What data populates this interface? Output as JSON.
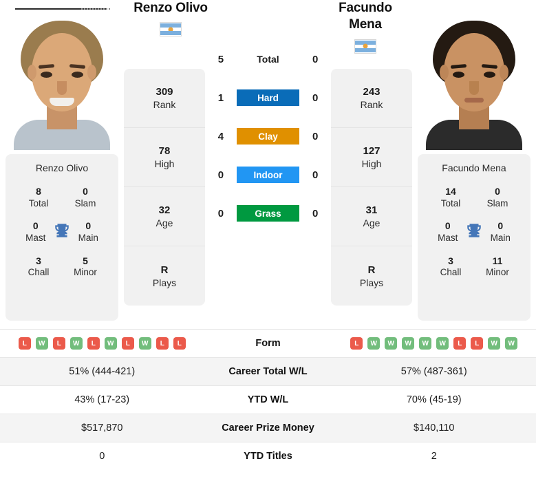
{
  "players": {
    "left": {
      "name": "Renzo Olivo",
      "flag_country": "Argentina",
      "card_name": "Renzo Olivo",
      "titles": {
        "total": "8",
        "total_label": "Total",
        "slam": "0",
        "slam_label": "Slam",
        "mast": "0",
        "mast_label": "Mast",
        "main": "0",
        "main_label": "Main",
        "chall": "3",
        "chall_label": "Chall",
        "minor": "5",
        "minor_label": "Minor"
      },
      "ranks": [
        {
          "value": "309",
          "label": "Rank"
        },
        {
          "value": "78",
          "label": "High"
        },
        {
          "value": "32",
          "label": "Age"
        },
        {
          "value": "R",
          "label": "Plays"
        }
      ],
      "h2h": {
        "total": "5",
        "hard": "1",
        "clay": "4",
        "indoor": "0",
        "grass": "0"
      },
      "form": [
        "L",
        "W",
        "L",
        "W",
        "L",
        "W",
        "L",
        "W",
        "L",
        "L"
      ],
      "career_wl": "51% (444-421)",
      "ytd_wl": "43% (17-23)",
      "career_prize": "$517,870",
      "ytd_titles": "0"
    },
    "right": {
      "name": "Facundo Mena",
      "name_line1": "Facundo",
      "name_line2": "Mena",
      "flag_country": "Argentina",
      "card_name": "Facundo Mena",
      "titles": {
        "total": "14",
        "total_label": "Total",
        "slam": "0",
        "slam_label": "Slam",
        "mast": "0",
        "mast_label": "Mast",
        "main": "0",
        "main_label": "Main",
        "chall": "3",
        "chall_label": "Chall",
        "minor": "11",
        "minor_label": "Minor"
      },
      "ranks": [
        {
          "value": "243",
          "label": "Rank"
        },
        {
          "value": "127",
          "label": "High"
        },
        {
          "value": "31",
          "label": "Age"
        },
        {
          "value": "R",
          "label": "Plays"
        }
      ],
      "h2h": {
        "total": "0",
        "hard": "0",
        "clay": "0",
        "indoor": "0",
        "grass": "0"
      },
      "form": [
        "L",
        "W",
        "W",
        "W",
        "W",
        "W",
        "L",
        "L",
        "W",
        "W"
      ],
      "career_wl": "57% (487-361)",
      "ytd_wl": "70% (45-19)",
      "career_prize": "$140,110",
      "ytd_titles": "2"
    }
  },
  "surfaces": [
    {
      "key": "total",
      "label": "Total",
      "color": "none",
      "text_color": "#1c1c1c"
    },
    {
      "key": "hard",
      "label": "Hard",
      "color": "#0a6cb8",
      "text_color": "#ffffff"
    },
    {
      "key": "clay",
      "label": "Clay",
      "color": "#e09000",
      "text_color": "#ffffff"
    },
    {
      "key": "indoor",
      "label": "Indoor",
      "color": "#2196f3",
      "text_color": "#ffffff"
    },
    {
      "key": "grass",
      "label": "Grass",
      "color": "#009940",
      "text_color": "#ffffff"
    }
  ],
  "table_labels": {
    "form": "Form",
    "career_total_wl": "Career Total W/L",
    "ytd_wl": "YTD W/L",
    "career_prize_money": "Career Prize Money",
    "ytd_titles": "YTD Titles"
  },
  "icons": {
    "trophy": "🏆",
    "trophy_name": "trophy-icon"
  },
  "colors": {
    "hard": "#0a6cb8",
    "clay": "#e09000",
    "indoor": "#2196f3",
    "grass": "#009940",
    "win": "#72bd7c",
    "loss": "#eb5a4b",
    "card_bg": "#f1f1f1",
    "row_shade": "#f4f4f4",
    "trophy": "#4476b8"
  }
}
